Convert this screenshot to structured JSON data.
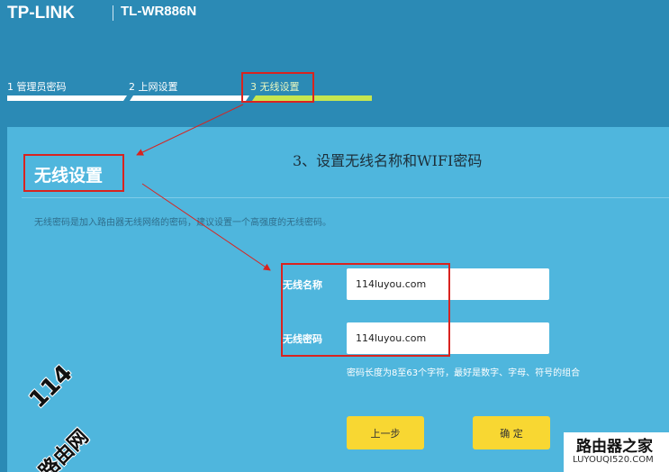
{
  "header": {
    "brand": "TP-LINK",
    "model": "TL-WR886N"
  },
  "steps": [
    {
      "label": "1 管理员密码",
      "state": "done"
    },
    {
      "label": "2 上网设置",
      "state": "done"
    },
    {
      "label": "3 无线设置",
      "state": "active"
    }
  ],
  "main": {
    "section_title": "无线设置",
    "instruction": "3、设置无线名称和WIFI密码",
    "description": "无线密码是加入路由器无线网络的密码，建议设置一个高强度的无线密码。",
    "fields": {
      "ssid_label": "无线名称",
      "ssid_value": "114luyou.com",
      "password_label": "无线密码",
      "password_value": "114luyou.com",
      "password_hint": "密码长度为8至63个字符，最好是数字、字母、符号的组合"
    },
    "buttons": {
      "prev": "上一步",
      "confirm": "确 定"
    }
  },
  "watermark": {
    "number": "114",
    "site_cn": "路由网",
    "corner_cn": "路由器之家",
    "corner_url": "LUYOUQI520.COM"
  },
  "colors": {
    "header_bg": "#2b8ab5",
    "content_bg": "#4fb6dd",
    "step_active": "#c6e64f",
    "button": "#f8d732",
    "annotation_red": "#d9231f"
  }
}
